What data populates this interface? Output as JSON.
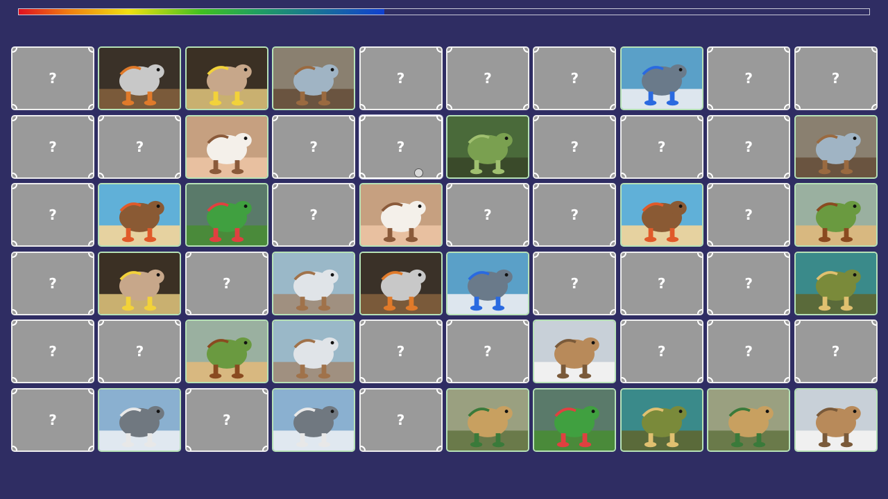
{
  "progress": 0.43,
  "hidden_label": "?",
  "rows": [
    [
      "hidden",
      "robot-rhino",
      "monkey-banana",
      "camel-car",
      "hidden",
      "hidden",
      "hidden",
      "shark-sneakers",
      "hidden",
      "hidden"
    ],
    [
      "hidden",
      "hidden",
      "coffee-cup-girl",
      "hidden",
      "hidden",
      "tree-crocodile",
      "hidden",
      "hidden",
      "hidden",
      "camel-car"
    ],
    [
      "hidden",
      "coconut-crab",
      "watermelon-crocodile",
      "hidden",
      "coffee-cup-girl",
      "hidden",
      "hidden",
      "coconut-crab",
      "hidden",
      "cactus-camel"
    ],
    [
      "hidden",
      "monkey-banana",
      "hidden",
      "fridge-camel",
      "robot-rhino",
      "shark-sneakers",
      "hidden",
      "hidden",
      "hidden",
      "fish-frog"
    ],
    [
      "hidden",
      "hidden",
      "cactus-camel",
      "fridge-camel",
      "hidden",
      "hidden",
      "potato-feet",
      "hidden",
      "hidden",
      "hidden"
    ],
    [
      "hidden",
      "crocodile-plane",
      "hidden",
      "crocodile-plane",
      "hidden",
      "potato-tractor",
      "watermelon-crocodile",
      "fish-frog",
      "potato-tractor",
      "potato-feet"
    ]
  ],
  "hover_cell": [
    1,
    4
  ],
  "creatures": {
    "robot-rhino": {
      "bg": "#3a3128",
      "ground": "#7a5a3a",
      "body": "#c8c8c8",
      "accent": "#e07a2a"
    },
    "monkey-banana": {
      "bg": "#3b3024",
      "ground": "#c9b070",
      "body": "#c7a78a",
      "accent": "#f2d23a"
    },
    "camel-car": {
      "bg": "#8a8070",
      "ground": "#6a5440",
      "body": "#a0b4c4",
      "accent": "#9a6a40"
    },
    "shark-sneakers": {
      "bg": "#5aa0c8",
      "ground": "#dde6ee",
      "body": "#6a7a8a",
      "accent": "#2a6ae0"
    },
    "coffee-cup-girl": {
      "bg": "#c6a080",
      "ground": "#e8c0a0",
      "body": "#f4f0ea",
      "accent": "#8a5a3a"
    },
    "tree-crocodile": {
      "bg": "#4a6a3a",
      "ground": "#3a4a2a",
      "body": "#7aa050",
      "accent": "#a0c070"
    },
    "coconut-crab": {
      "bg": "#60b0d8",
      "ground": "#e6d2a0",
      "body": "#8a5a34",
      "accent": "#e05a2a"
    },
    "watermelon-crocodile": {
      "bg": "#5a7a6a",
      "ground": "#4a8a3a",
      "body": "#40a040",
      "accent": "#e04040"
    },
    "cactus-camel": {
      "bg": "#9ab0a0",
      "ground": "#d8b880",
      "body": "#6a9a40",
      "accent": "#8a4a20"
    },
    "fridge-camel": {
      "bg": "#9ab8c8",
      "ground": "#a09080",
      "body": "#e0e4e8",
      "accent": "#a0724a"
    },
    "fish-frog": {
      "bg": "#3a8a8a",
      "ground": "#5a6a3a",
      "body": "#7a8a3a",
      "accent": "#e0c070"
    },
    "potato-feet": {
      "bg": "#c8d0d8",
      "ground": "#f0f0f0",
      "body": "#b88a5a",
      "accent": "#7a5a3a"
    },
    "crocodile-plane": {
      "bg": "#8ab0d0",
      "ground": "#e0e8f0",
      "body": "#707880",
      "accent": "#e8e8e8"
    },
    "potato-tractor": {
      "bg": "#9aa080",
      "ground": "#6a7a4a",
      "body": "#c8a060",
      "accent": "#3a7a3a"
    }
  }
}
